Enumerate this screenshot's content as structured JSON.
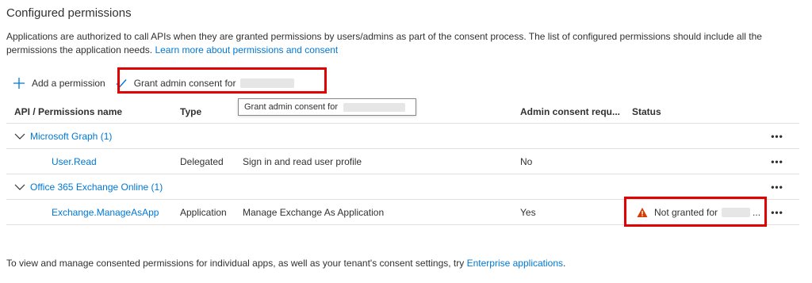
{
  "section": {
    "title": "Configured permissions",
    "description": "Applications are authorized to call APIs when they are granted permissions by users/admins as part of the consent process. The list of configured permissions should include all the permissions the application needs.",
    "learn_more_link": "Learn more about permissions and consent"
  },
  "toolbar": {
    "add_permission_label": "Add a permission",
    "grant_consent_label": "Grant admin consent for"
  },
  "tooltip": {
    "text": "Grant admin consent for"
  },
  "table": {
    "columns": [
      "API / Permissions name",
      "Type",
      "Admin consent requ...",
      "Status"
    ],
    "groups": [
      {
        "label": "Microsoft Graph (1)",
        "permissions": [
          {
            "name": "User.Read",
            "type": "Delegated",
            "description": "Sign in and read user profile",
            "admin_consent": "No",
            "status": ""
          }
        ]
      },
      {
        "label": "Office 365 Exchange Online (1)",
        "permissions": [
          {
            "name": "Exchange.ManageAsApp",
            "type": "Application",
            "description": "Manage Exchange As Application",
            "admin_consent": "Yes",
            "status": "Not granted for",
            "status_suffix": "..."
          }
        ]
      }
    ],
    "more_glyph": "•••"
  },
  "footer": {
    "text": "To view and manage consented permissions for individual apps, as well as your tenant's consent settings, try",
    "link": "Enterprise applications",
    "end": "."
  },
  "colors": {
    "accent": "#0078d4",
    "highlight_box": "#e00000",
    "warning": "#d83b01"
  }
}
